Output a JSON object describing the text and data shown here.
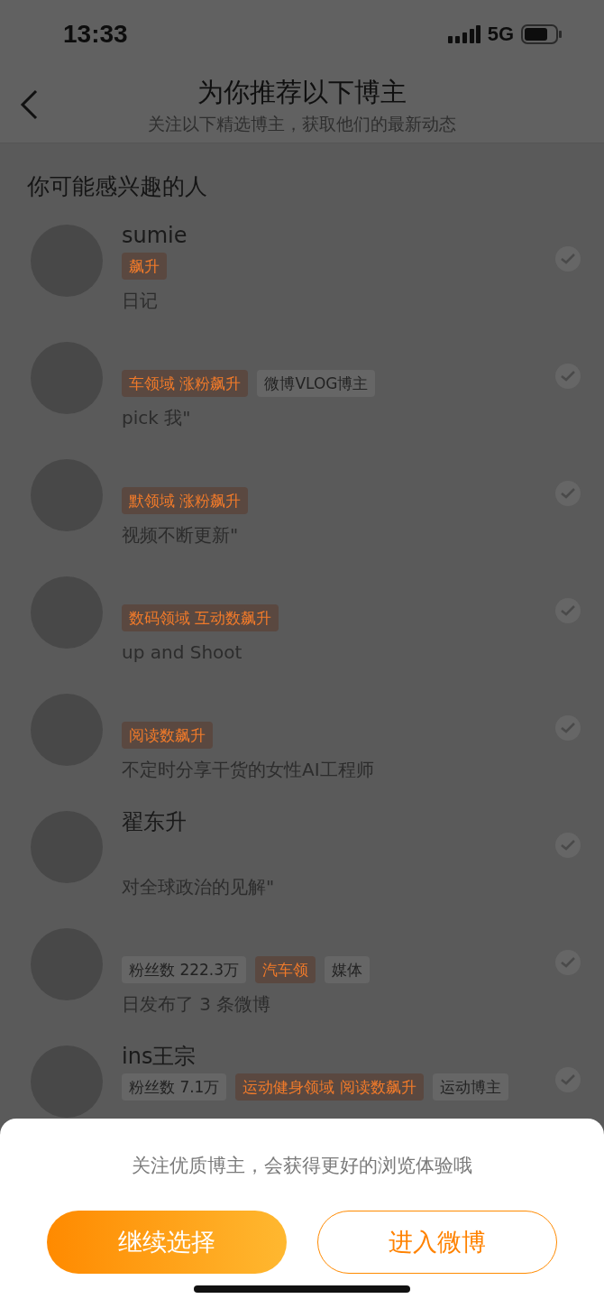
{
  "status_bar": {
    "time": "13:33",
    "network": "5G"
  },
  "header": {
    "title": "为你推荐以下博主",
    "subtitle": "关注以下精选博主，获取他们的最新动态"
  },
  "section_title": "你可能感兴趣的人",
  "bloggers": [
    {
      "name": "sumie",
      "tags": [
        {
          "kind": "hot",
          "text": "飙升"
        }
      ],
      "description": "日记",
      "checked": false
    },
    {
      "tags": [
        {
          "kind": "hot",
          "text": "车领域 涨粉飙升"
        },
        {
          "kind": "label",
          "text": "微博VLOG博主"
        }
      ],
      "description": "pick 我\"",
      "checked": false
    },
    {
      "tags": [
        {
          "kind": "hot",
          "text": "默领域 涨粉飙升"
        }
      ],
      "description": "视频不断更新\"",
      "checked": false
    },
    {
      "tags": [
        {
          "kind": "hot",
          "text": "数码领域 互动数飙升"
        }
      ],
      "description": "up and Shoot",
      "checked": false
    },
    {
      "tags": [
        {
          "kind": "hot",
          "text": "阅读数飙升"
        }
      ],
      "description": "不定时分享干货的女性AI工程师",
      "checked": false
    },
    {
      "name": "翟东升",
      "description": "对全球政治的见解\"",
      "checked": false
    },
    {
      "tags": [
        {
          "kind": "fans",
          "text": "粉丝数 222.3万"
        },
        {
          "kind": "hot",
          "text": "汽车领"
        },
        {
          "kind": "label",
          "text": "媒体"
        }
      ],
      "description": "日发布了 3 条微博",
      "checked": false
    },
    {
      "name": "ins王宗",
      "tags": [
        {
          "kind": "fans",
          "text": "粉丝数 7.1万"
        },
        {
          "kind": "hot",
          "text": "运动健身领域 阅读数飙升"
        },
        {
          "kind": "label",
          "text": "运动博主"
        }
      ],
      "checked": false
    }
  ],
  "sheet": {
    "message": "关注优质博主，会获得更好的浏览体验哦",
    "buttons": [
      {
        "kind": "primary",
        "label": "继续选择"
      },
      {
        "kind": "secondary",
        "label": "进入微博"
      }
    ]
  }
}
